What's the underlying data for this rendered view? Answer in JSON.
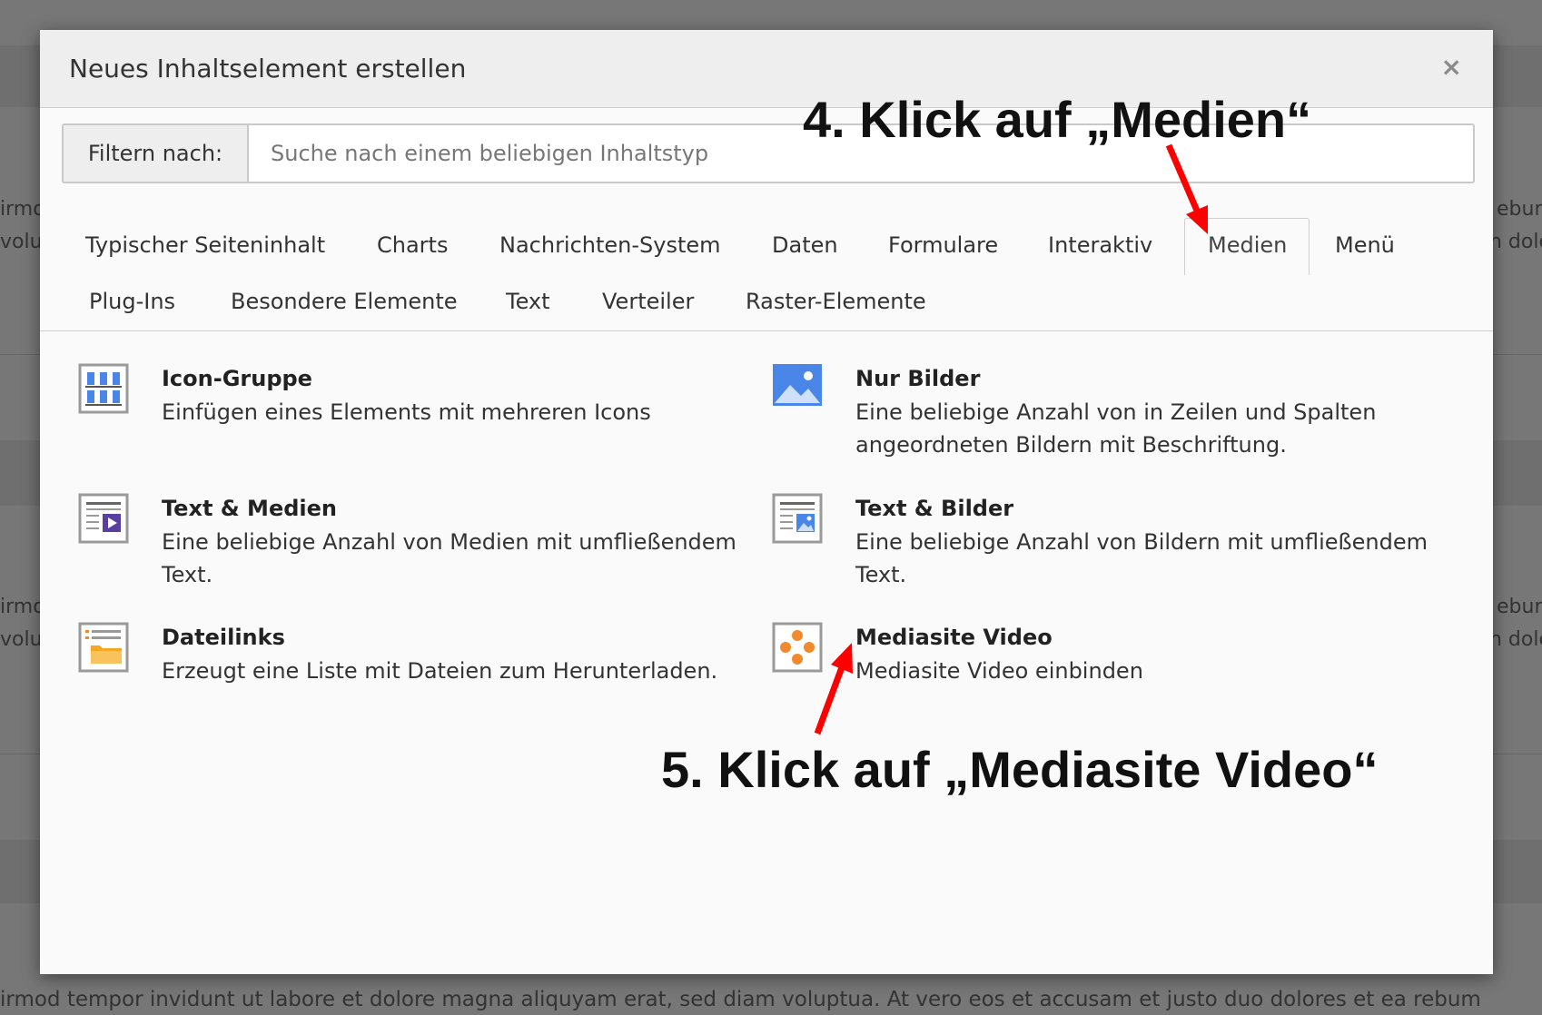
{
  "dialog": {
    "title": "Neues Inhaltselement erstellen",
    "close_symbol": "×"
  },
  "filter": {
    "label": "Filtern nach:",
    "placeholder": "Suche nach einem beliebigen Inhaltstyp",
    "value": ""
  },
  "tabs": [
    {
      "label": "Typischer Seiteninhalt"
    },
    {
      "label": "Charts"
    },
    {
      "label": "Nachrichten-System"
    },
    {
      "label": "Daten"
    },
    {
      "label": "Formulare"
    },
    {
      "label": "Interaktiv"
    },
    {
      "label": "Medien",
      "active": true
    },
    {
      "label": "Menü"
    },
    {
      "label": "Plug-Ins"
    },
    {
      "label": "Besondere Elemente"
    },
    {
      "label": "Text"
    },
    {
      "label": "Verteiler"
    },
    {
      "label": "Raster-Elemente"
    }
  ],
  "items": [
    {
      "title": "Icon-Gruppe",
      "description": "Einfügen eines Elements mit mehreren Icons",
      "icon": "icon-group-icon"
    },
    {
      "title": "Nur Bilder",
      "description": "Eine beliebige Anzahl von in Zeilen und Spalten angeordneten Bildern mit Beschriftung.",
      "icon": "images-icon"
    },
    {
      "title": "Text & Medien",
      "description": "Eine beliebige Anzahl von Medien mit umfließendem Text.",
      "icon": "text-media-icon"
    },
    {
      "title": "Text & Bilder",
      "description": "Eine beliebige Anzahl von Bildern mit umfließendem Text.",
      "icon": "text-images-icon"
    },
    {
      "title": "Dateilinks",
      "description": "Erzeugt eine Liste mit Dateien zum Herunterladen.",
      "icon": "file-links-icon"
    },
    {
      "title": "Mediasite Video",
      "description": "Mediasite Video einbinden",
      "icon": "mediasite-icon"
    }
  ],
  "annotations": {
    "step4": "4. Klick auf „Medien“",
    "step5": "5. Klick auf „Mediasite Video“"
  },
  "background": {
    "left_snippets": [
      "irmo",
      "volu",
      "irmo",
      "volu"
    ],
    "right_snippets": [
      "ebur",
      "n dolo",
      "ebur",
      "n dolo"
    ],
    "bottom_text": "irmod tempor invidunt ut labore et dolore magna aliquyam erat, sed diam voluptua. At vero eos et accusam et justo duo dolores et ea rebum"
  },
  "colors": {
    "arrow": "#ff0000",
    "blue_icon": "#4a86e8",
    "purple_icon": "#5b3f9e",
    "orange_icon": "#f18a2c"
  }
}
